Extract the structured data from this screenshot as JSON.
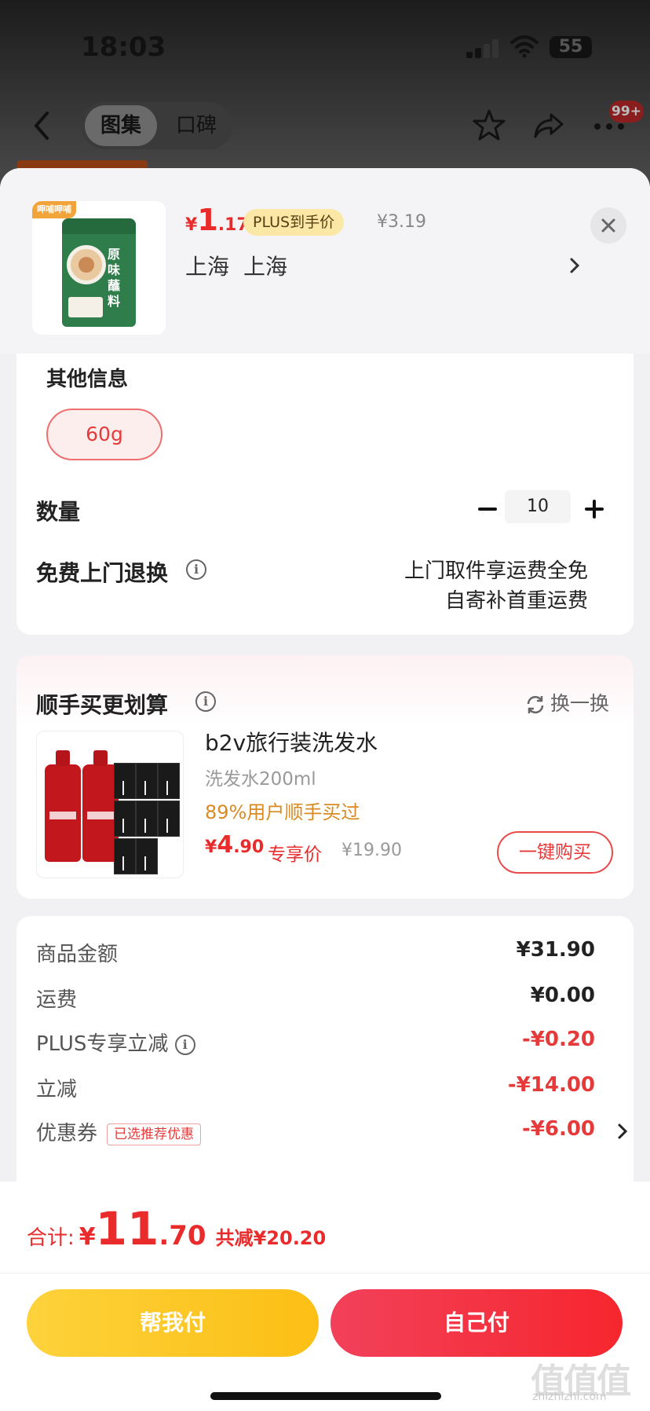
{
  "status_bar": {
    "time": "18:03",
    "battery": "55"
  },
  "nav": {
    "tab_active": "图集",
    "tab_inactive": "口碑",
    "badge": "99+"
  },
  "product": {
    "brand_tag": "呷哺呷哺",
    "package_text": "原味蘸料",
    "price_symbol": "¥",
    "price_int": "1",
    "price_dec": ".17",
    "plus_label": "PLUS到手价",
    "original_price": "¥3.19",
    "location_province": "上海",
    "location_city": "上海"
  },
  "options": {
    "other_info_label": "其他信息",
    "size": "60g",
    "quantity_label": "数量",
    "quantity": "10",
    "return_label": "免费上门退换",
    "return_line1": "上门取件享运费全免",
    "return_line2": "自寄补首重运费"
  },
  "addon": {
    "title": "顺手买更划算",
    "refresh_label": "换一换",
    "name": "b2v旅行装洗发水",
    "spec": "洗发水200ml",
    "buy_rate": "89%用户顺手买过",
    "price_symbol": "¥",
    "price_int": "4",
    "price_dec": ".90",
    "exclusive_label": "专享价",
    "original_price": "¥19.90",
    "buy_button": "一键购买"
  },
  "summary": {
    "rows": [
      {
        "label": "商品金额",
        "value": "¥31.90"
      },
      {
        "label": "运费",
        "value": "¥0.00"
      },
      {
        "label": "PLUS专享立减",
        "value": "-¥0.20"
      },
      {
        "label": "立减",
        "value": "-¥14.00"
      },
      {
        "label": "优惠券",
        "value": "-¥6.00",
        "tag": "已选推荐优惠"
      }
    ]
  },
  "footer": {
    "total_label": "合计:",
    "total_symbol": "¥",
    "total_int": "11",
    "total_dec": ".70",
    "total_saved": "共减¥20.20",
    "help_pay": "帮我付",
    "self_pay": "自己付",
    "watermark": "值值值",
    "watermark_sub": "zhizhizhi.com"
  },
  "colors": {
    "accent_red": "#e92b2b",
    "plus_gold": "#fbe8a6",
    "yellow_button": "#fcbf15"
  }
}
